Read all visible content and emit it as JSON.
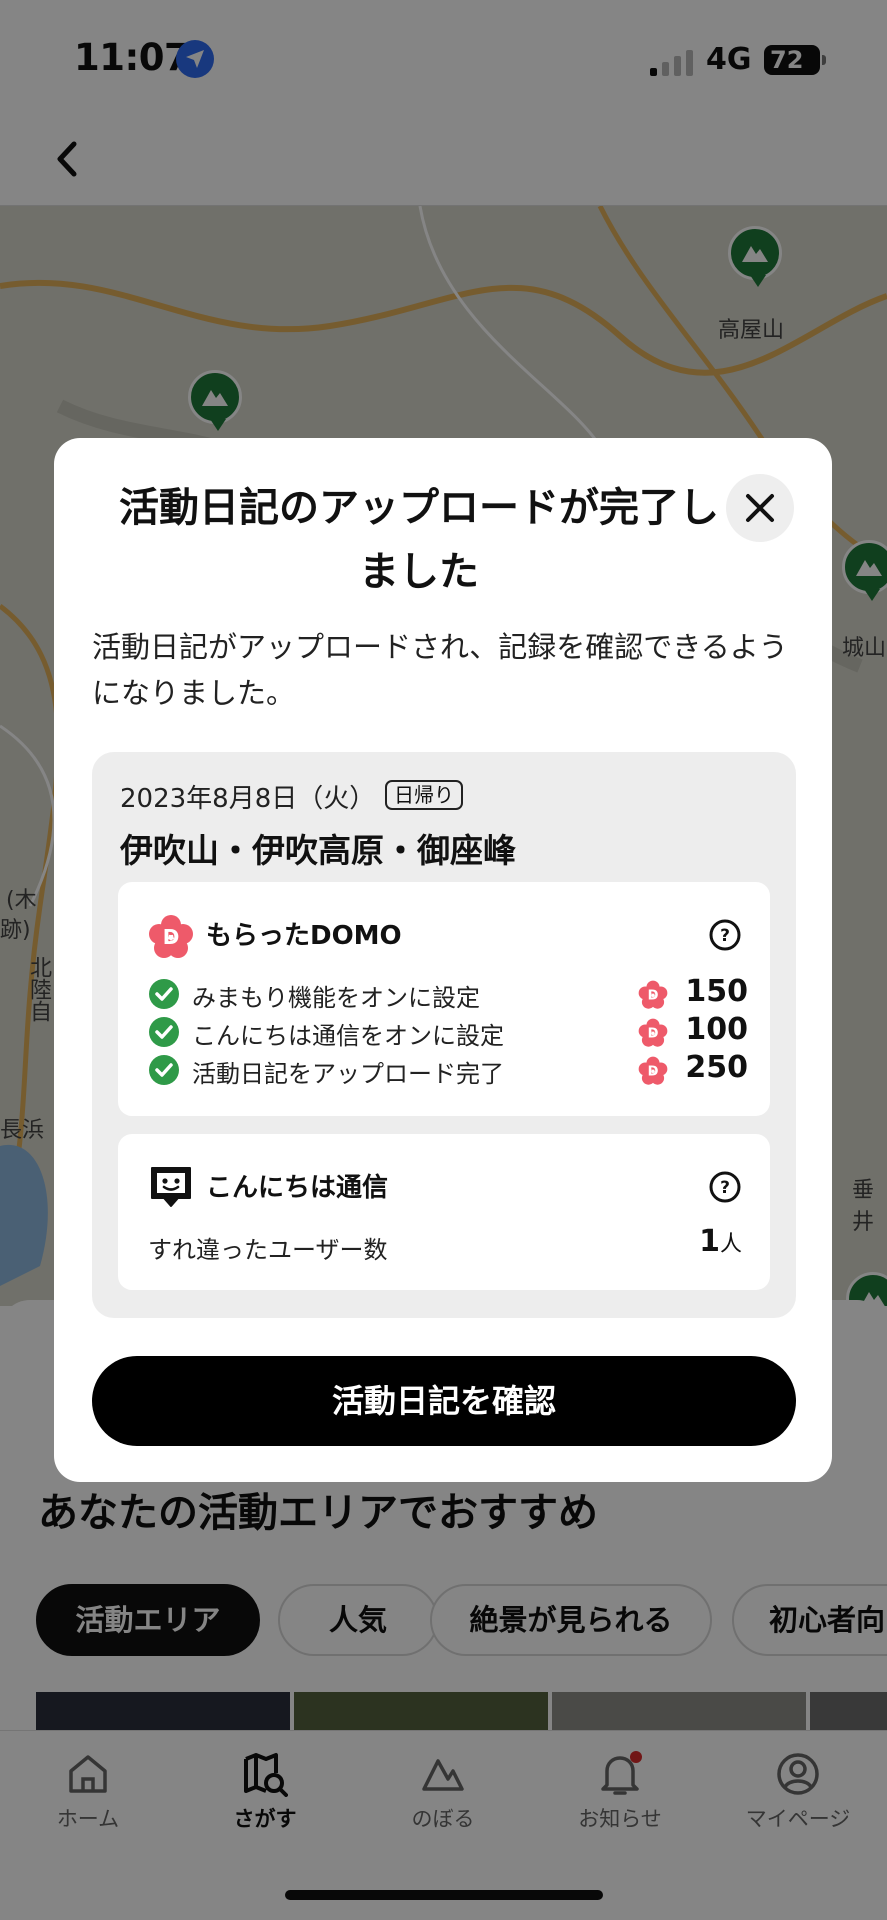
{
  "status_bar": {
    "time": "11:07",
    "network": "4G",
    "battery": "72"
  },
  "map": {
    "labels": [
      "高屋山",
      "城山",
      "長浜",
      "垂井",
      "北陸自",
      "(木",
      "跡)"
    ],
    "colors": {
      "terrain": "#d9d9cf",
      "road": "#e3b15a",
      "pin": "#1f7a3a",
      "water": "#8fb9de"
    }
  },
  "recommend": {
    "title": "あなたの活動エリアでおすすめ",
    "chips": [
      "活動エリア",
      "人気",
      "絶景が見られる",
      "初心者向"
    ]
  },
  "tabbar": {
    "tabs": [
      {
        "label": "ホーム",
        "icon": "home-icon"
      },
      {
        "label": "さがす",
        "icon": "map-search-icon"
      },
      {
        "label": "のぼる",
        "icon": "mountain-icon"
      },
      {
        "label": "お知らせ",
        "icon": "bell-icon"
      },
      {
        "label": "マイページ",
        "icon": "user-icon"
      }
    ],
    "active_index": 1
  },
  "modal": {
    "title": "活動日記のアップロードが完了しました",
    "description": "活動日記がアップロードされ、記録を確認できるようになりました。",
    "date": "2023年8月8日（火）",
    "trip_type": "日帰り",
    "peak_name": "伊吹山・伊吹高原・御座峰",
    "domo": {
      "heading": "もらったDOMO",
      "items": [
        {
          "label": "みまもり機能をオンに設定",
          "points": "150"
        },
        {
          "label": "こんにちは通信をオンに設定",
          "points": "100"
        },
        {
          "label": "活動日記をアップロード完了",
          "points": "250"
        }
      ]
    },
    "konnichiwa": {
      "heading": "こんにちは通信",
      "label": "すれ違ったユーザー数",
      "count": "1",
      "unit": "人"
    },
    "cta_label": "活動日記を確認"
  }
}
